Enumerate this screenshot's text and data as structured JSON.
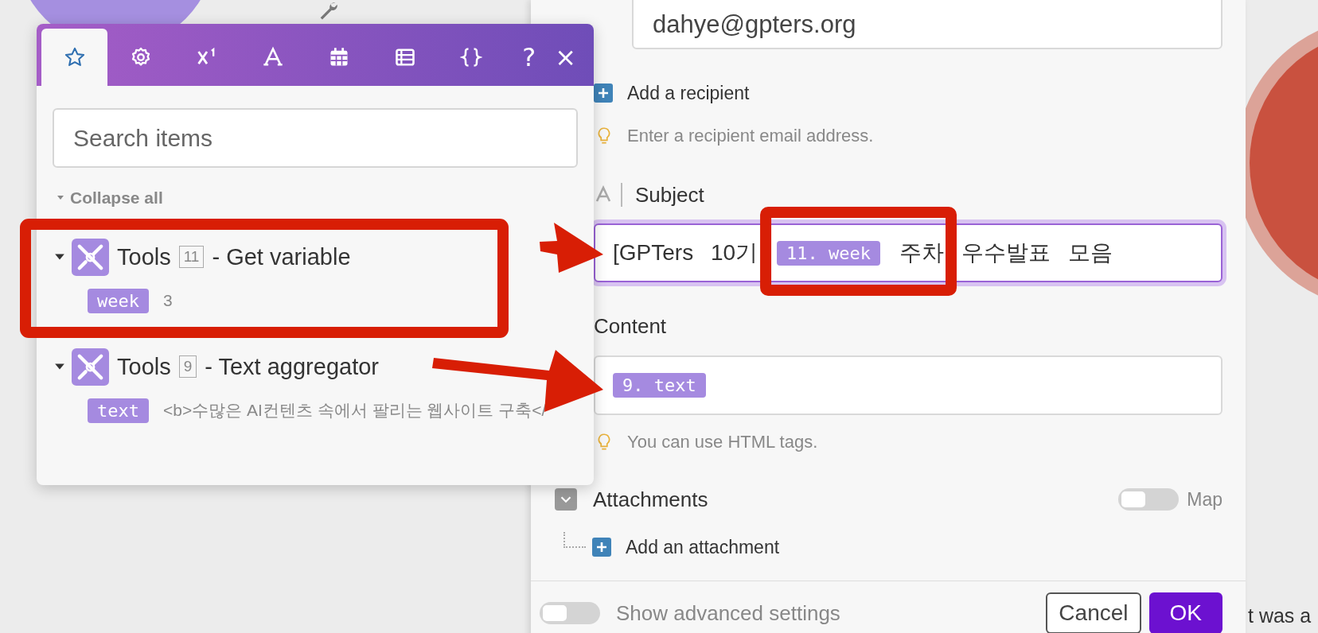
{
  "popup": {
    "tabs": [
      {
        "kind": "star",
        "selected": true
      },
      {
        "kind": "gear",
        "selected": false
      },
      {
        "kind": "superscript",
        "selected": false
      },
      {
        "kind": "letter",
        "selected": false
      },
      {
        "kind": "calendar",
        "selected": false
      },
      {
        "kind": "table",
        "selected": false
      },
      {
        "kind": "braces",
        "selected": false
      }
    ],
    "help": "?",
    "close": "×",
    "search": {
      "placeholder": "Search items"
    },
    "collapse_all": "Collapse all",
    "modules": [
      {
        "name": "Tools",
        "number": "11",
        "action": "- Get variable",
        "expanded": true,
        "items": [
          {
            "key": "week",
            "value": "3"
          }
        ]
      },
      {
        "name": "Tools",
        "number": "9",
        "action": "- Text aggregator",
        "expanded": true,
        "items": [
          {
            "key": "text",
            "value": "<b>수많은 AI컨텐츠 속에서 팔리는 웹사이트 구축</"
          }
        ]
      }
    ]
  },
  "panel": {
    "recipient": {
      "value": "dahye@gpters.org"
    },
    "add_recipient": "Add a recipient",
    "recipient_hint": "Enter a recipient email address.",
    "subject": {
      "label": "Subject",
      "focused": true,
      "tokens": [
        {
          "kind": "text",
          "text": "[GPTers 10기"
        },
        {
          "kind": "pill",
          "text": "11. week"
        },
        {
          "kind": "text",
          "text": "주차 우수발표 모음"
        }
      ]
    },
    "content": {
      "label": "Content",
      "focused": false,
      "tokens": [
        {
          "kind": "pill",
          "text": "9. text"
        }
      ]
    },
    "content_hint": "You can use HTML tags.",
    "attachments": {
      "label": "Attachments",
      "expanded": true,
      "map": {
        "label": "Map",
        "on": false
      },
      "add": "Add an attachment"
    },
    "advanced": {
      "label": "Show advanced settings",
      "on": false
    },
    "buttons": [
      {
        "kind": "secondary",
        "label": "Cancel"
      },
      {
        "kind": "primary",
        "label": "OK"
      }
    ]
  },
  "edge_text": "t was a"
}
